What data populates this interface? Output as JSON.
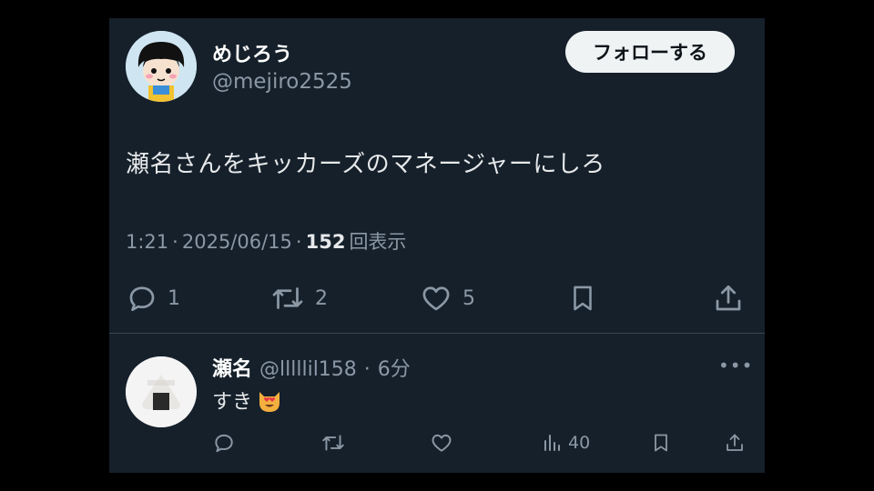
{
  "tweet": {
    "author_name": "めじろう",
    "author_handle": "@mejiro2525",
    "follow_label": "フォローする",
    "text": "瀬名さんをキッカーズのマネージャーにしろ",
    "time": "1:21",
    "date": "2025/06/15",
    "views_count": "152",
    "views_label": "回表示",
    "replies": "1",
    "reposts": "2",
    "likes": "5"
  },
  "reply": {
    "author_name": "瀬名",
    "author_handle": "@lllllil158",
    "time_ago": "6分",
    "text": "すき",
    "views": "40",
    "emoji": "smiling-cat-heart-eyes-emoji"
  },
  "colors": {
    "background": "#15202b",
    "muted": "#8b98a5",
    "text": "#e7e9ea",
    "divider": "#38444d"
  }
}
